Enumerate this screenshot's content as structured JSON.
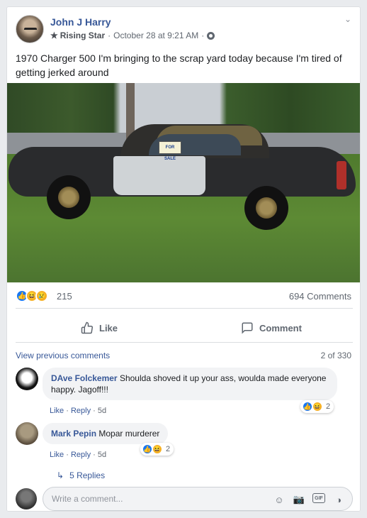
{
  "post": {
    "author": "John J Harry",
    "badge": "Rising Star",
    "separator": "·",
    "timestamp": "October 28 at 9:21 AM",
    "text": "1970 Charger 500 I'm bringing to the scrap yard today because I'm tired of getting jerked around",
    "photo_sign_text": "FOR SALE"
  },
  "stats": {
    "reaction_count": "215",
    "comments_count": "694 Comments"
  },
  "actions": {
    "like_label": "Like",
    "comment_label": "Comment"
  },
  "comments": {
    "view_previous": "View previous comments",
    "page_indicator": "2 of 330",
    "items": [
      {
        "name": "DAve Folckemer",
        "text": "Shoulda shoved it up your ass, woulda made everyone happy. Jagoff!!!",
        "like": "Like",
        "reply": "Reply",
        "sep": "·",
        "time": "5d",
        "reaction_count": "2"
      },
      {
        "name": "Mark Pepin",
        "text": "Mopar murderer",
        "like": "Like",
        "reply": "Reply",
        "sep": "·",
        "time": "5d",
        "reaction_count": "2"
      }
    ],
    "replies_label": "5 Replies",
    "write_placeholder": "Write a comment..."
  },
  "icons": {
    "badge": "star-icon",
    "privacy": "globe-icon",
    "options": "chevron-down-icon",
    "reactions": [
      "like-reaction-icon",
      "haha-reaction-icon",
      "sad-reaction-icon"
    ],
    "input": [
      "emoji-icon",
      "camera-icon",
      "gif-icon",
      "sticker-icon"
    ]
  },
  "colors": {
    "link": "#385898",
    "like_blue": "#1877f2",
    "reaction_yellow": "#f7b125"
  }
}
